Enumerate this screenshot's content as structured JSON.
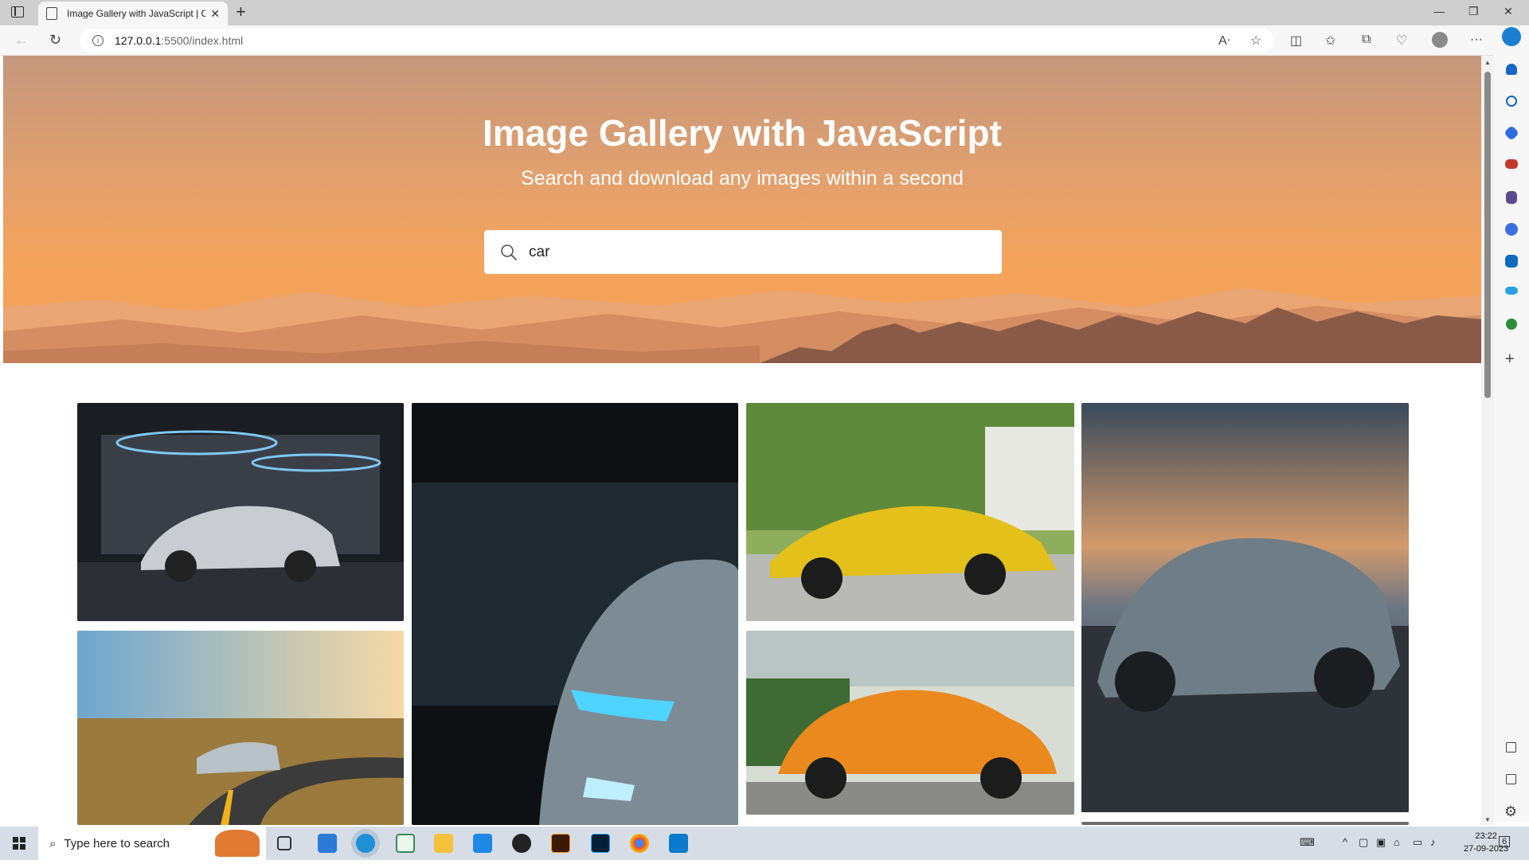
{
  "browser": {
    "tab_title": "Image Gallery with JavaScript | C",
    "url_host": "127.0.0.1",
    "url_path": ":5500/index.html"
  },
  "hero": {
    "title": "Image Gallery with JavaScript",
    "subtitle": "Search and download any images within a second",
    "search_value": "car"
  },
  "taskbar": {
    "search_placeholder": "Type here to search",
    "time": "23:22",
    "date": "27-09-2023",
    "notification_count": "6"
  },
  "colors": {
    "hero_top": "#c4977d",
    "hero_bottom": "#f5a35a",
    "accent": "#0078d4"
  }
}
